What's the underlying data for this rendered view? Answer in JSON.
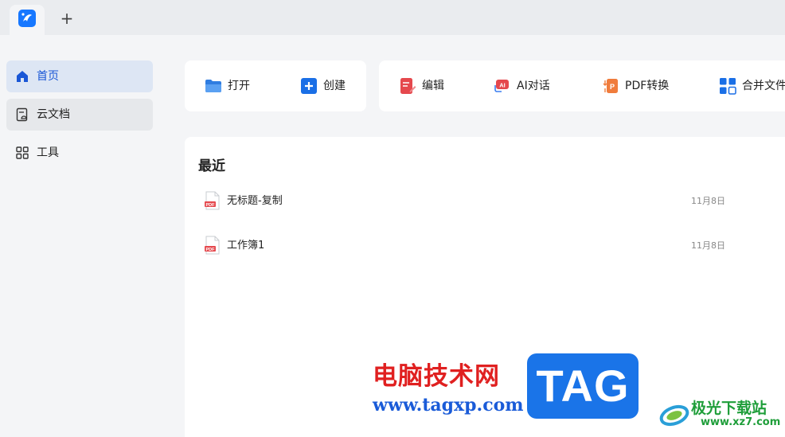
{
  "tabs": {
    "new_tab_label": "+"
  },
  "sidebar": {
    "items": [
      {
        "label": "首页",
        "icon": "home-icon",
        "state": "active"
      },
      {
        "label": "云文档",
        "icon": "cloud-doc-icon",
        "state": "hover"
      },
      {
        "label": "工具",
        "icon": "grid-tools-icon",
        "state": "normal"
      }
    ]
  },
  "toolbar_left": [
    {
      "label": "打开",
      "icon": "folder-open-icon"
    },
    {
      "label": "创建",
      "icon": "plus-square-icon"
    }
  ],
  "toolbar_right": [
    {
      "label": "编辑",
      "icon": "edit-doc-icon"
    },
    {
      "label": "AI对话",
      "icon": "ai-chat-icon"
    },
    {
      "label": "PDF转换",
      "icon": "pdf-convert-icon"
    },
    {
      "label": "合并文件",
      "icon": "merge-files-icon"
    }
  ],
  "recent": {
    "title": "最近",
    "files": [
      {
        "name": "无标题-复制",
        "date": "11月8日",
        "icon": "pdf-file-icon"
      },
      {
        "name": "工作簿1",
        "date": "11月8日",
        "icon": "pdf-file-icon"
      }
    ]
  },
  "watermark": {
    "site_cn": "电脑技术网",
    "site_url": "www.tagxp.com",
    "tag": "TAG",
    "xz_cn": "极光下载站",
    "xz_url": "www.xz7.com"
  },
  "colors": {
    "accent": "#1a57d6",
    "active_bg": "#dde6f4",
    "watermark_red": "#e02020",
    "watermark_blue": "#1a74e8",
    "watermark_green": "#1f9e3a"
  }
}
